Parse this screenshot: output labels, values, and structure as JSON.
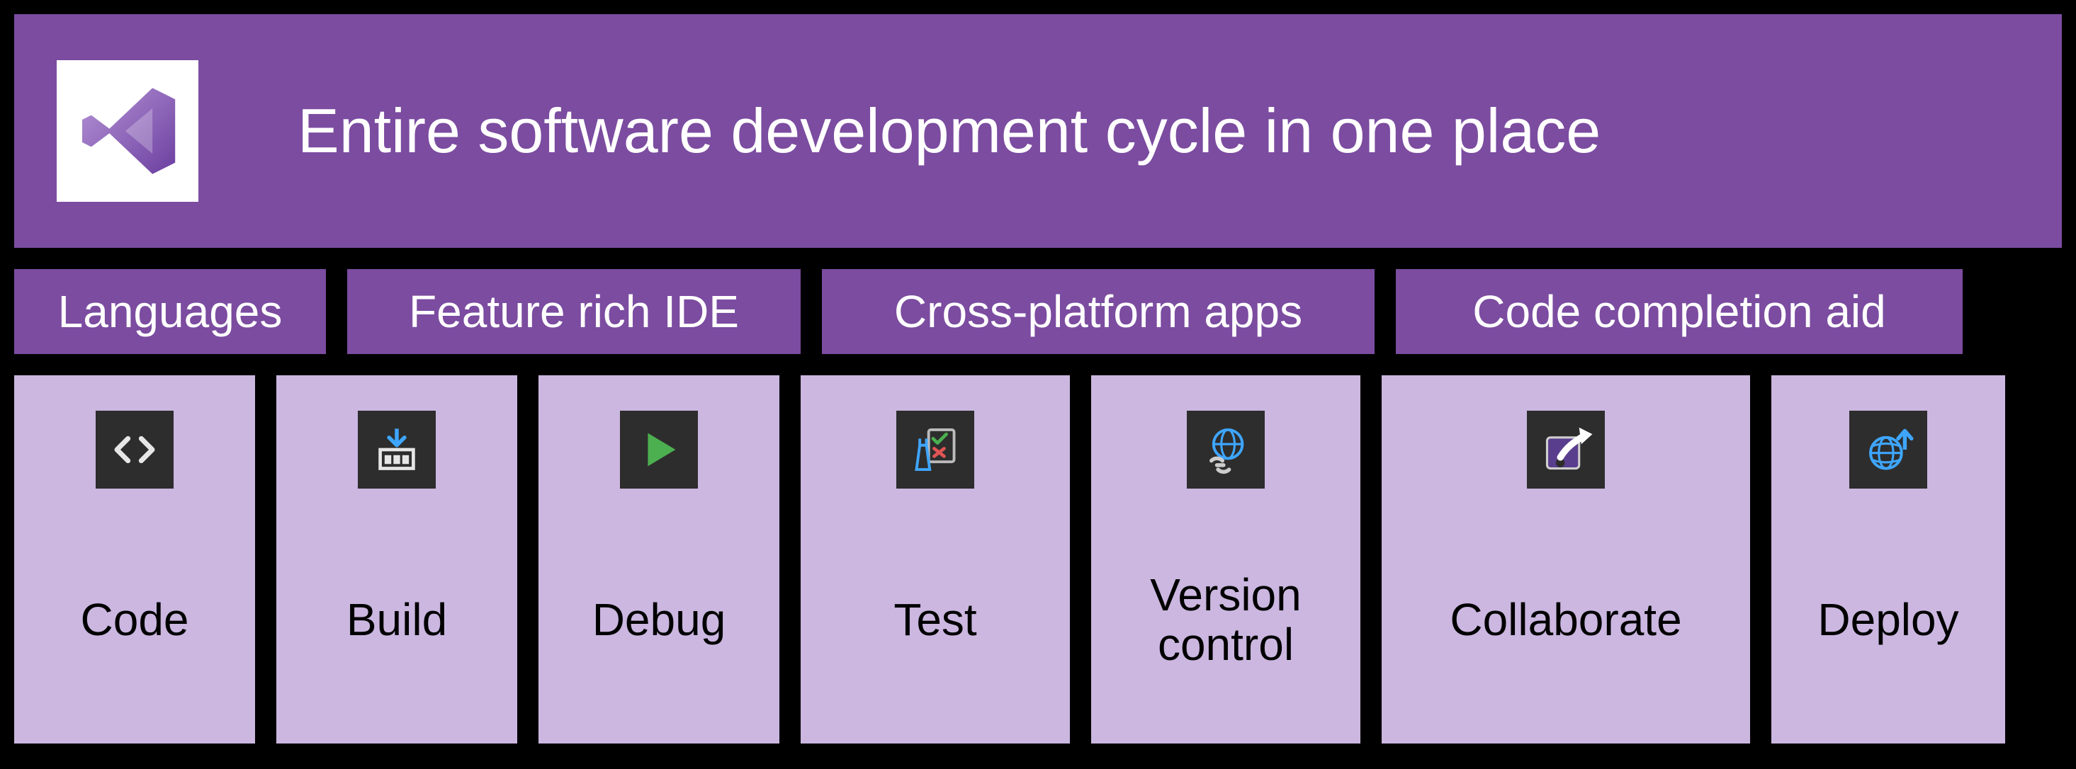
{
  "header": {
    "title": "Entire software development cycle in one place",
    "logo": "visual-studio"
  },
  "features": [
    {
      "label": "Languages"
    },
    {
      "label": "Feature rich IDE"
    },
    {
      "label": "Cross-platform apps"
    },
    {
      "label": "Code completion aid"
    }
  ],
  "stages": [
    {
      "label": "Code",
      "icon": "code-icon"
    },
    {
      "label": "Build",
      "icon": "build-icon"
    },
    {
      "label": "Debug",
      "icon": "play-icon"
    },
    {
      "label": "Test",
      "icon": "test-icon"
    },
    {
      "label": "Version control",
      "icon": "globe-link-icon"
    },
    {
      "label": "Collaborate",
      "icon": "share-icon"
    },
    {
      "label": "Deploy",
      "icon": "globe-upload-icon"
    }
  ],
  "colors": {
    "brand": "#7b4ca0",
    "card": "#cbb7e0",
    "bg": "#000000",
    "icon_bg": "#2d2d2d"
  }
}
